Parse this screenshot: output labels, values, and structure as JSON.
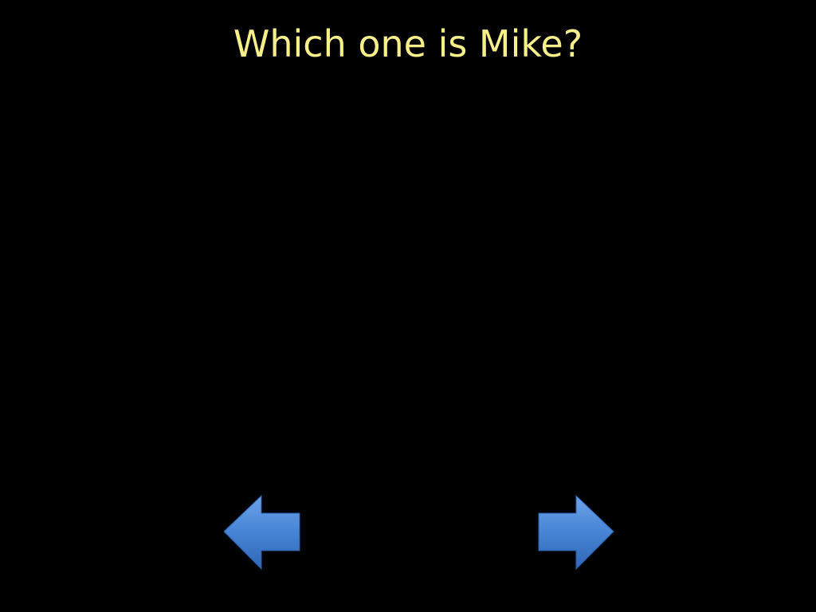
{
  "slide": {
    "title": "Which one is Mike?"
  },
  "navigation": {
    "previous_icon": "arrow-left-icon",
    "next_icon": "arrow-right-icon"
  },
  "colors": {
    "background": "#000000",
    "title": "#f6ef8a",
    "arrow_fill": "#3f7ed3"
  }
}
